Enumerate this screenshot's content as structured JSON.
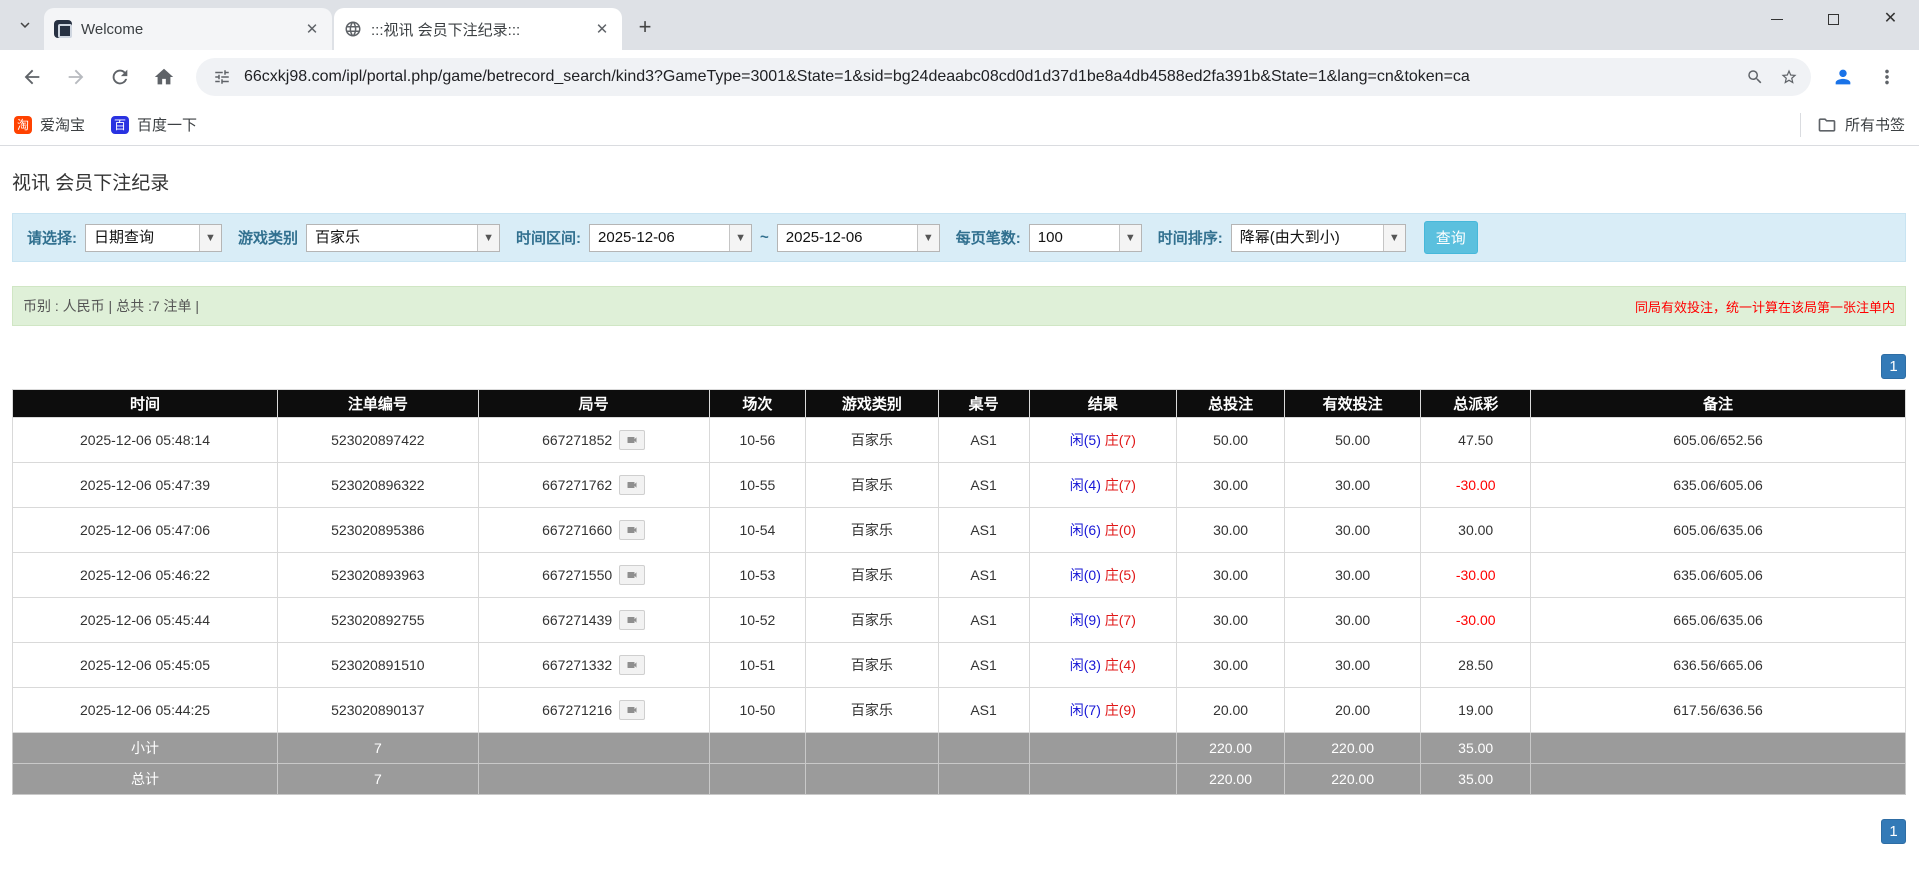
{
  "browser": {
    "tabs": [
      {
        "title": "Welcome"
      },
      {
        "title": ":::视讯 会员下注纪录:::"
      }
    ],
    "url": "66cxkj98.com/ipl/portal.php/game/betrecord_search/kind3?GameType=3001&State=1&sid=bg24deaabc08cd0d1d37d1be8a4db4588ed2fa391b&State=1&lang=cn&token=ca",
    "bookmarks": {
      "taobao": "爱淘宝",
      "baidu": "百度一下",
      "all_bookmarks": "所有书签"
    }
  },
  "page": {
    "title": "视讯 会员下注纪录"
  },
  "filters": {
    "select_label": "请选择:",
    "select_value": "日期查询",
    "game_label": "游戏类别",
    "game_value": "百家乐",
    "range_label": "时间区间:",
    "date_from": "2025-12-06",
    "range_sep": "~",
    "date_to": "2025-12-06",
    "per_page_label": "每页笔数:",
    "per_page_value": "100",
    "sort_label": "时间排序:",
    "sort_value": "降幂(由大到小)",
    "query_button": "查询"
  },
  "summary_bar": {
    "left": "币别 : 人民币 | 总共 :7 注单 |",
    "notice": "同局有效投注，统一计算在该局第一张注单内"
  },
  "pagination": {
    "page": "1"
  },
  "table": {
    "headers": [
      "时间",
      "注单编号",
      "局号",
      "场次",
      "游戏类别",
      "桌号",
      "结果",
      "总投注",
      "有效投注",
      "总派彩",
      "备注"
    ],
    "rows": [
      {
        "time": "2025-12-06 05:48:14",
        "bet_id": "523020897422",
        "round_id": "667271852",
        "session": "10-56",
        "game": "百家乐",
        "table_no": "AS1",
        "player": "闲(5)",
        "banker": "庄(7)",
        "total_bet": "50.00",
        "valid_bet": "50.00",
        "payout": "47.50",
        "note": "605.06/652.56"
      },
      {
        "time": "2025-12-06 05:47:39",
        "bet_id": "523020896322",
        "round_id": "667271762",
        "session": "10-55",
        "game": "百家乐",
        "table_no": "AS1",
        "player": "闲(4)",
        "banker": "庄(7)",
        "total_bet": "30.00",
        "valid_bet": "30.00",
        "payout": "-30.00",
        "note": "635.06/605.06"
      },
      {
        "time": "2025-12-06 05:47:06",
        "bet_id": "523020895386",
        "round_id": "667271660",
        "session": "10-54",
        "game": "百家乐",
        "table_no": "AS1",
        "player": "闲(6)",
        "banker": "庄(0)",
        "total_bet": "30.00",
        "valid_bet": "30.00",
        "payout": "30.00",
        "note": "605.06/635.06"
      },
      {
        "time": "2025-12-06 05:46:22",
        "bet_id": "523020893963",
        "round_id": "667271550",
        "session": "10-53",
        "game": "百家乐",
        "table_no": "AS1",
        "player": "闲(0)",
        "banker": "庄(5)",
        "total_bet": "30.00",
        "valid_bet": "30.00",
        "payout": "-30.00",
        "note": "635.06/605.06"
      },
      {
        "time": "2025-12-06 05:45:44",
        "bet_id": "523020892755",
        "round_id": "667271439",
        "session": "10-52",
        "game": "百家乐",
        "table_no": "AS1",
        "player": "闲(9)",
        "banker": "庄(7)",
        "total_bet": "30.00",
        "valid_bet": "30.00",
        "payout": "-30.00",
        "note": "665.06/635.06"
      },
      {
        "time": "2025-12-06 05:45:05",
        "bet_id": "523020891510",
        "round_id": "667271332",
        "session": "10-51",
        "game": "百家乐",
        "table_no": "AS1",
        "player": "闲(3)",
        "banker": "庄(4)",
        "total_bet": "30.00",
        "valid_bet": "30.00",
        "payout": "28.50",
        "note": "636.56/665.06"
      },
      {
        "time": "2025-12-06 05:44:25",
        "bet_id": "523020890137",
        "round_id": "667271216",
        "session": "10-50",
        "game": "百家乐",
        "table_no": "AS1",
        "player": "闲(7)",
        "banker": "庄(9)",
        "total_bet": "20.00",
        "valid_bet": "20.00",
        "payout": "19.00",
        "note": "617.56/636.56"
      }
    ],
    "subtotal": {
      "label": "小计",
      "count": "7",
      "total_bet": "220.00",
      "valid_bet": "220.00",
      "payout": "35.00"
    },
    "total": {
      "label": "总计",
      "count": "7",
      "total_bet": "220.00",
      "valid_bet": "220.00",
      "payout": "35.00"
    }
  },
  "colors": {
    "accent_blue": "#337ab7",
    "filter_bg": "#d9edf7",
    "info_bg": "#dff0d8",
    "header_bg": "#0d0d0d",
    "summary_bg": "#9b9b9b",
    "player_blue": "#1717d6",
    "banker_red": "#e01717",
    "negative_red": "#ff0000",
    "query_btn": "#5bc0de"
  }
}
